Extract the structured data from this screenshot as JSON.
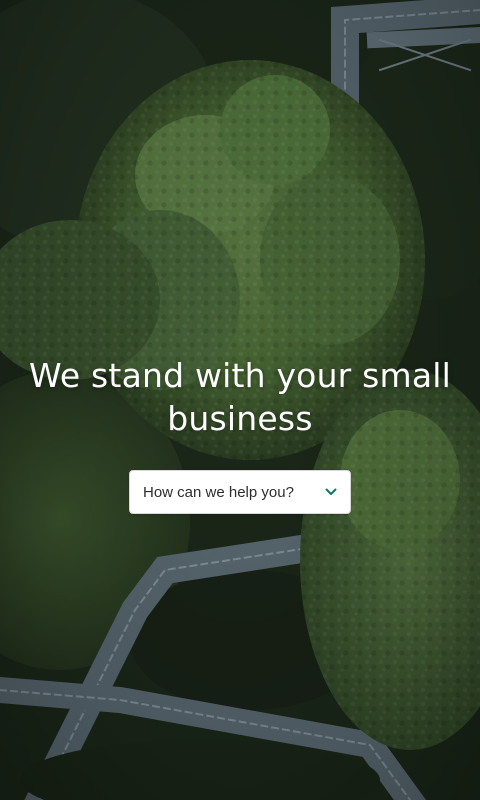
{
  "hero": {
    "headline": "We stand with your small business",
    "background": {
      "icon": "forest-canopy-walkway-photo",
      "colors": {
        "foliage_dark": "#1d2a1b",
        "foliage_mid": "#3a5530",
        "foliage_light": "#56753f",
        "walkway": "#6e7f8a"
      }
    }
  },
  "help_select": {
    "label": "How can we help you?",
    "icon": "chevron-down-icon",
    "accent_color": "#0a7b5c"
  }
}
